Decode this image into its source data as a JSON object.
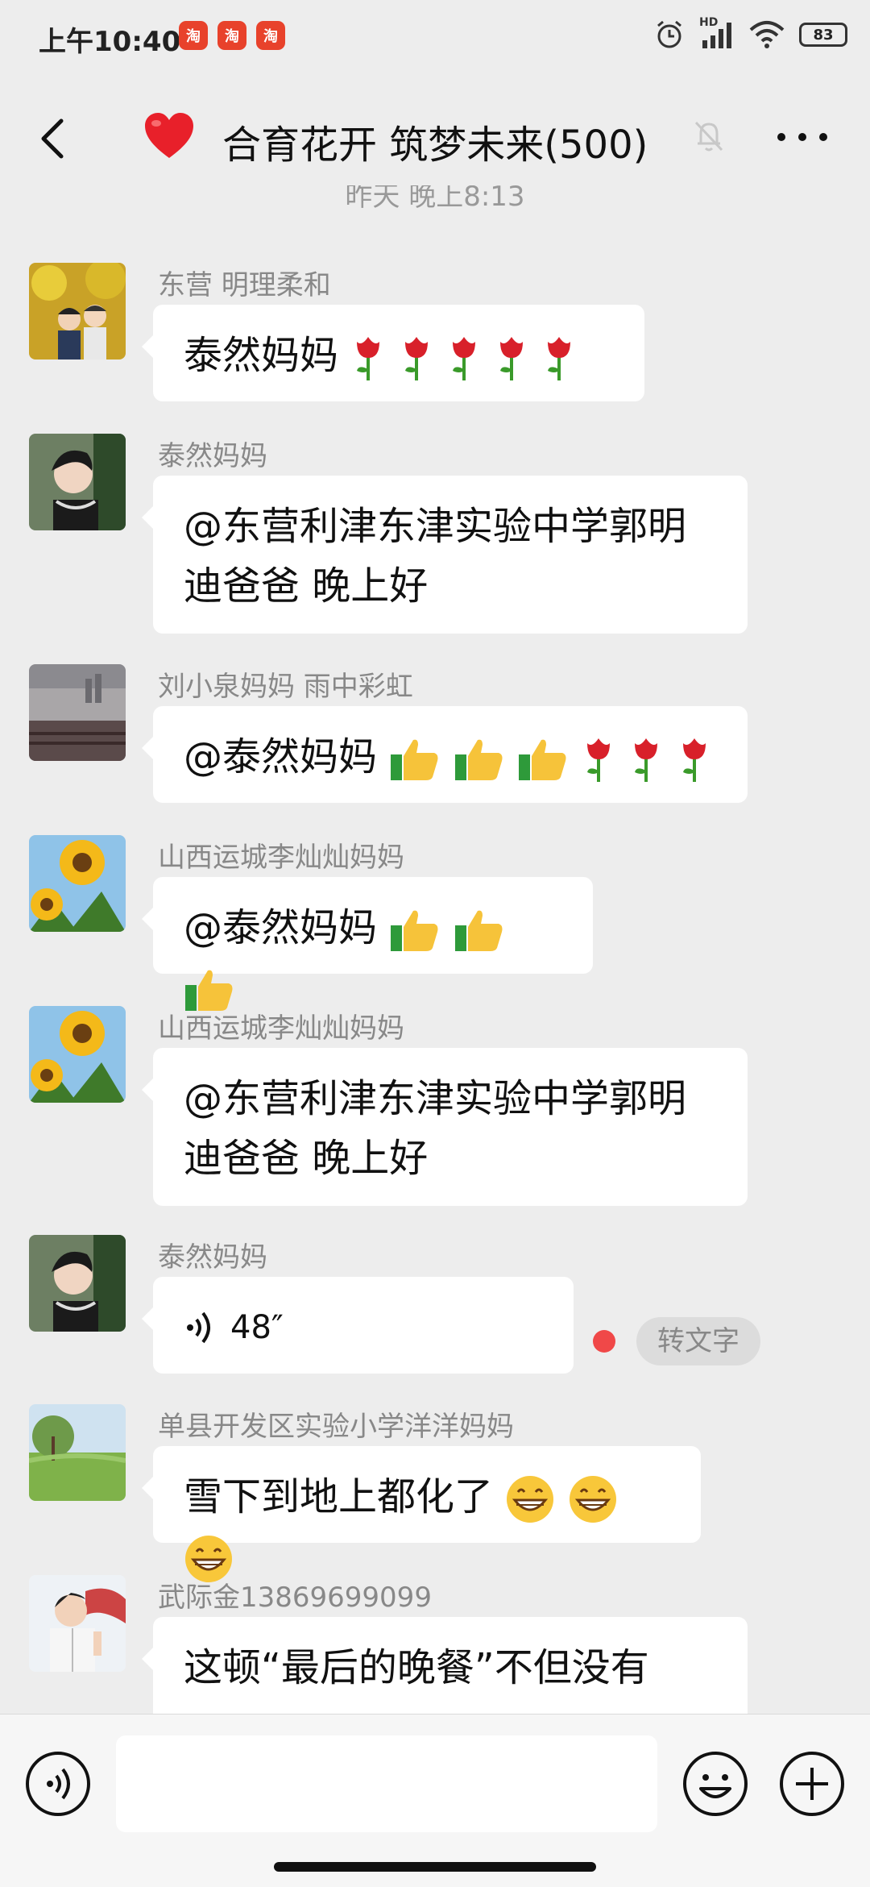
{
  "status_bar": {
    "time": "上午10:40",
    "app_icons": [
      "淘",
      "淘",
      "淘"
    ],
    "battery": "83",
    "network_label": "HD"
  },
  "header": {
    "title": "合育花开 筑梦未来(500)",
    "back_icon": "back-icon",
    "mute_icon": "bell-muted-icon",
    "more_icon": "more-icon"
  },
  "chat": {
    "timestamp": "昨天 晚上8:13",
    "messages": [
      {
        "sender": "东营  明理柔和",
        "text": "泰然妈妈",
        "emojis": [
          "rose",
          "rose",
          "rose",
          "rose",
          "rose"
        ]
      },
      {
        "sender": "泰然妈妈",
        "line1": "@东营利津东津实验中学郭明",
        "line2": "迪爸爸  晚上好"
      },
      {
        "sender": "刘小泉妈妈  雨中彩虹",
        "text": "@泰然妈妈 ",
        "emojis": [
          "thumbs-up",
          "thumbs-up",
          "thumbs-up",
          "rose",
          "rose",
          "rose"
        ]
      },
      {
        "sender": "山西运城李灿灿妈妈",
        "text": "@泰然妈妈 ",
        "emojis": [
          "thumbs-up",
          "thumbs-up",
          "thumbs-up"
        ]
      },
      {
        "sender": "山西运城李灿灿妈妈",
        "line1": "@东营利津东津实验中学郭明",
        "line2": "迪爸爸  晚上好"
      },
      {
        "sender": "泰然妈妈",
        "voice_duration": "48″",
        "convert_label": "转文字"
      },
      {
        "sender": "单县开发区实验小学洋洋妈妈",
        "text": "雪下到地上都化了",
        "emojis": [
          "grin",
          "grin",
          "grin"
        ]
      },
      {
        "sender": "武际金13869699099",
        "line1": "这顿“最后的晚餐”不但没有"
      }
    ]
  },
  "colors": {
    "background": "#ededed",
    "bubble": "#ffffff",
    "unread": "#f04848",
    "heart": "#e8202a"
  }
}
